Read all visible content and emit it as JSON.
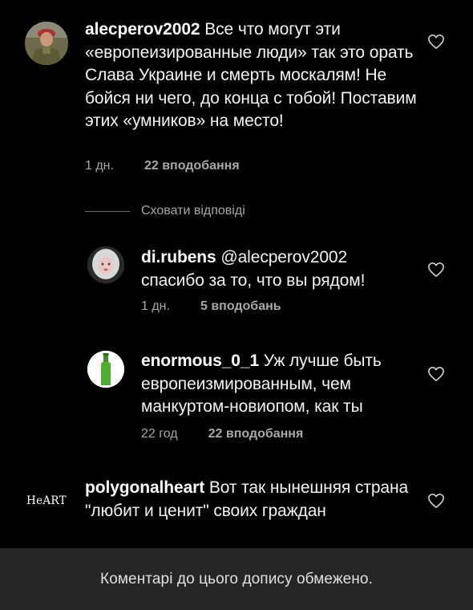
{
  "comments": [
    {
      "username": "alecperov2002",
      "text": "Все что могут эти «европеизированные люди» так это орать Слава Украине и смерть москалям! Не бойся ни чего, до конца с тобой! Поставим этих «умников» на место!",
      "time": "1 дн.",
      "likes": "22 вподобання"
    },
    {
      "username": "di.rubens",
      "text": "@alecperov2002 спасибо за то, что вы рядом!",
      "time": "1 дн.",
      "likes": "5 вподобань"
    },
    {
      "username": "enormous_0_1",
      "text": "Уж лучше быть европеизмированным, чем манкуртом-новиопом, как ты",
      "time": "22 год",
      "likes": "22 вподобання"
    },
    {
      "username": "polygonalheart",
      "text": "Вот так нынешняя страна \"любит и ценит\" своих граждан",
      "avatar_text": "HeART"
    }
  ],
  "hide_replies_label": "Сховати відповіді",
  "footer_text": "Коментарі до цього допису обмежено.",
  "icons": {
    "like": "heart-outline-icon"
  },
  "colors": {
    "background": "#000000",
    "footer_bg": "#262626",
    "secondary_text": "#a8a8a8",
    "bottle_green": "#4caf2e"
  }
}
